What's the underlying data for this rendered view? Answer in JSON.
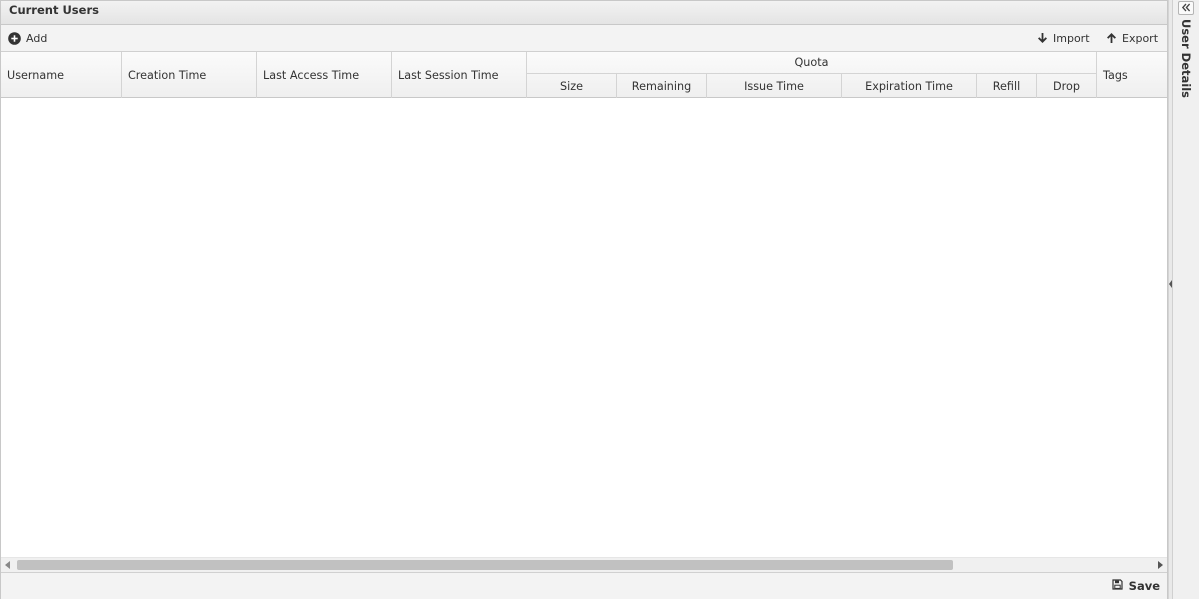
{
  "panel": {
    "title": "Current Users"
  },
  "toolbar": {
    "add_label": "Add",
    "import_label": "Import",
    "export_label": "Export"
  },
  "grid": {
    "columns": {
      "username": "Username",
      "creation_time": "Creation Time",
      "last_access_time": "Last Access Time",
      "last_session_time": "Last Session Time",
      "quota": "Quota",
      "size": "Size",
      "remaining": "Remaining",
      "issue_time": "Issue Time",
      "expiration_time": "Expiration Time",
      "refill": "Refill",
      "drop": "Drop",
      "tags": "Tags"
    },
    "rows": []
  },
  "footer": {
    "save_label": "Save"
  },
  "side_panel": {
    "title": "User Details"
  },
  "icons": {
    "add": "plus-circle-icon",
    "import": "arrow-down-icon",
    "export": "arrow-up-icon",
    "save": "floppy-disk-icon",
    "expand": "double-chevron-left-icon"
  }
}
